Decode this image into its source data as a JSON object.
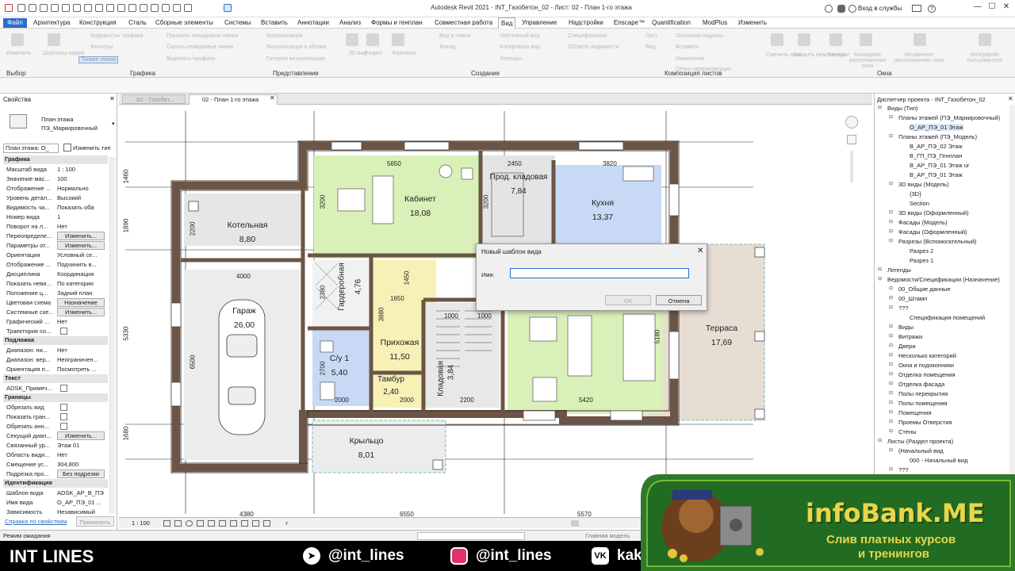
{
  "window": {
    "title": "Autodesk Revit 2021 - INT_Газобетон_02 - Лист: 02 - План 1-го этажа",
    "signin": "Вход в службы"
  },
  "menu": [
    "Файл",
    "Архитектура",
    "Конструкция",
    "Сталь",
    "Сборные элементы",
    "Системы",
    "Вставить",
    "Аннотации",
    "Анализ",
    "Формы и генплан",
    "Совместная работа",
    "Вид",
    "Управление",
    "Надстройки",
    "Enscape™",
    "Quantification",
    "ModPlus",
    "Изменить"
  ],
  "ribbon": {
    "groups": [
      "Выбор",
      "Графика",
      "Представление",
      "Создание",
      "Композиция листов",
      "Окна"
    ],
    "items": [
      "Изменить",
      "Шаблоны видов",
      "Видимость/ графика",
      "Фильтры",
      "Тонкие линии",
      "Показать невидимые линии",
      "Скрыть невидимые линии",
      "Вырезать профиль",
      "Визуализация",
      "Визуализация в облаке",
      "Галерея визуализации",
      "3D вид",
      "Разрез",
      "Фрагмент",
      "Вид в плане",
      "Фасад",
      "Чертежный вид",
      "Копировать вид",
      "Легенды",
      "Спецификации",
      "Область видимости",
      "Лист",
      "Вид",
      "Основная надпись",
      "Вставить",
      "Изменения",
      "Сетка направляющих",
      "Сменить окно",
      "Закрыть неактивные",
      "Вкладки",
      "Каскадное расположение окон",
      "Мозаичное расположение окон",
      "Интерфейс пользователя"
    ]
  },
  "properties": {
    "header": "Свойства",
    "type_name_1": "План этажа",
    "type_name_2": "ПЭ_Маркировочный",
    "instance_select": "План этажа: О_",
    "edit_type": "Изменить тип",
    "sections": [
      {
        "title": "Графика",
        "rows": [
          [
            "Масштаб вида",
            "1 : 100"
          ],
          [
            "Значение мас...",
            "100"
          ],
          [
            "Отображение ...",
            "Нормально"
          ],
          [
            "Уровень детал...",
            "Высокий"
          ],
          [
            "Видимость ча...",
            "Показать оба"
          ],
          [
            "Номер вида",
            "1"
          ],
          [
            "Поворот на л...",
            "Нет"
          ],
          [
            "Переопределе...",
            "Изменить..."
          ],
          [
            "Параметры от...",
            "Изменить..."
          ],
          [
            "Ориентация",
            "Условный се..."
          ],
          [
            "Отображение ...",
            "Подчинить в..."
          ],
          [
            "Дисциплина",
            "Координация"
          ],
          [
            "Показать неви...",
            "По категории"
          ],
          [
            "Положение ц...",
            "Задний план"
          ],
          [
            "Цветовая схема",
            "Назначение"
          ],
          [
            "Системные схе...",
            "Изменить..."
          ],
          [
            "Графический ...",
            "Нет"
          ],
          [
            "Траектория со...",
            ""
          ]
        ]
      },
      {
        "title": "Подложка",
        "rows": [
          [
            "Диапазон: ни...",
            "Нет"
          ],
          [
            "Диапазон: вер...",
            "Неограничен..."
          ],
          [
            "Ориентация п...",
            "Посмотреть ..."
          ]
        ]
      },
      {
        "title": "Текст",
        "rows": [
          [
            "ADSK_Примеч...",
            ""
          ]
        ]
      },
      {
        "title": "Границы",
        "rows": [
          [
            "Обрезать вид",
            ""
          ],
          [
            "Показать гран...",
            ""
          ],
          [
            "Обрезать анн...",
            ""
          ],
          [
            "Секущий диап...",
            "Изменить..."
          ],
          [
            "Связанный ур...",
            "Этаж 01"
          ],
          [
            "Область види...",
            "Нет"
          ],
          [
            "Смещение ус...",
            "304,800"
          ],
          [
            "Подрезка про...",
            "Без подрезки"
          ]
        ]
      },
      {
        "title": "Идентификация",
        "rows": [
          [
            "Шаблон вида",
            "ADSK_АР_В_ПЭ"
          ],
          [
            "Имя вида",
            "О_АР_ПЭ_01 ..."
          ],
          [
            "Зависимость",
            "Независимый"
          ]
        ]
      }
    ],
    "help_link": "Справка по свойствам",
    "apply": "Применить"
  },
  "view_tabs": [
    "3D - Газобет...",
    "02 - План 1-го этажа"
  ],
  "dialog": {
    "title": "Новый шаблон вида",
    "name_label": "Имя:",
    "name_value": "",
    "ok": "ОК",
    "cancel": "Отмена"
  },
  "rooms": [
    {
      "name": "Котельная",
      "area": "8,80"
    },
    {
      "name": "Кабинет",
      "area": "18,08"
    },
    {
      "name": "Прод. кладовая",
      "area": "7,84"
    },
    {
      "name": "Кухня",
      "area": "13,37"
    },
    {
      "name": "Гараж",
      "area": "26,00"
    },
    {
      "name": "Гардеробная",
      "area": "4,76"
    },
    {
      "name": "Прихожая",
      "area": "11,50"
    },
    {
      "name": "С/у 1",
      "area": "5,40"
    },
    {
      "name": "Тамбур",
      "area": "2,40"
    },
    {
      "name": "Кладовая",
      "area": "3,84"
    },
    {
      "name": "Терраса",
      "area": "17,69"
    },
    {
      "name": "Крыльцо",
      "area": "8,01"
    }
  ],
  "dimensions": [
    "5650",
    "2450",
    "3820",
    "1460",
    "1890",
    "5330",
    "1680",
    "2200",
    "4000",
    "6500",
    "3200",
    "3200",
    "2380",
    "1650",
    "1450",
    "3880",
    "1000",
    "1000",
    "5180",
    "2700",
    "2000",
    "2000",
    "2200",
    "5420",
    "4380",
    "6550",
    "5570"
  ],
  "browser": {
    "title": "Диспетчер проекта - INT_Газобетон_02",
    "items": [
      {
        "t": "Виды (Тип)",
        "lvl": 0
      },
      {
        "t": "Планы этажей (ПЭ_Маркировочный)",
        "lvl": 1
      },
      {
        "t": "О_АР_ПЭ_01 Этаж",
        "lvl": 2,
        "sel": true
      },
      {
        "t": "Планы этажей (ПЭ_Модель)",
        "lvl": 1
      },
      {
        "t": "В_АР_ПЭ_02 Этаж",
        "lvl": 2
      },
      {
        "t": "В_ГП_ПЭ_Генплан",
        "lvl": 2
      },
      {
        "t": "В_АР_ПЭ_01 Этаж ur",
        "lvl": 2
      },
      {
        "t": "В_АР_ПЭ_01 Этаж",
        "lvl": 2
      },
      {
        "t": "3D виды (Модель)",
        "lvl": 1
      },
      {
        "t": "{3D}",
        "lvl": 2
      },
      {
        "t": "Section",
        "lvl": 2
      },
      {
        "t": "3D виды (Оформленный)",
        "lvl": 1
      },
      {
        "t": "Фасады (Модель)",
        "lvl": 1
      },
      {
        "t": "Фасады (Оформленный)",
        "lvl": 1
      },
      {
        "t": "Разрезы (Вспомогательный)",
        "lvl": 1
      },
      {
        "t": "Разрез 2",
        "lvl": 2
      },
      {
        "t": "Разрез 1",
        "lvl": 2
      },
      {
        "t": "Легенды",
        "lvl": 0
      },
      {
        "t": "Ведомости/Спецификации (Назначение)",
        "lvl": 0
      },
      {
        "t": "00_Общие данные",
        "lvl": 1
      },
      {
        "t": "00_Штамп",
        "lvl": 1
      },
      {
        "t": "???",
        "lvl": 1
      },
      {
        "t": "Спецификация помещений",
        "lvl": 2
      },
      {
        "t": "Виды",
        "lvl": 1
      },
      {
        "t": "Витражи",
        "lvl": 1
      },
      {
        "t": "Двери",
        "lvl": 1
      },
      {
        "t": "Несколько категорий",
        "lvl": 1
      },
      {
        "t": "Окна и подоконники",
        "lvl": 1
      },
      {
        "t": "Отделка помещения",
        "lvl": 1
      },
      {
        "t": "Отделка фасада",
        "lvl": 1
      },
      {
        "t": "Полы перекрытия",
        "lvl": 1
      },
      {
        "t": "Полы помещения",
        "lvl": 1
      },
      {
        "t": "Помещения",
        "lvl": 1
      },
      {
        "t": "Проемы Отверстия",
        "lvl": 1
      },
      {
        "t": "Стены",
        "lvl": 1
      },
      {
        "t": "Листы (Раздел проекта)",
        "lvl": 0
      },
      {
        "t": "(Начальный вид",
        "lvl": 1
      },
      {
        "t": "000 - Начальный вид",
        "lvl": 2
      },
      {
        "t": "???",
        "lvl": 1
      }
    ]
  },
  "viewbar": {
    "scale": "1 : 100"
  },
  "status": {
    "left": "Режим ожидания",
    "model": "Главная модель"
  },
  "footer": {
    "brand": "INT LINES",
    "telegram": "@int_lines",
    "instagram": "@int_lines",
    "vk": "kak_"
  },
  "promo": {
    "brand": "infoBank.ME",
    "line1": "Слив платных курсов",
    "line2": "и тренингов"
  },
  "colors": {
    "file_tab": "#2e6cc7",
    "wall": "#6b5546",
    "green_room": "#d9f0b8",
    "blue_room": "#c7d9f4",
    "yellow_room": "#f7f1b8",
    "beige_room": "#e7ddd3",
    "promo_text": "#e8d64a"
  }
}
